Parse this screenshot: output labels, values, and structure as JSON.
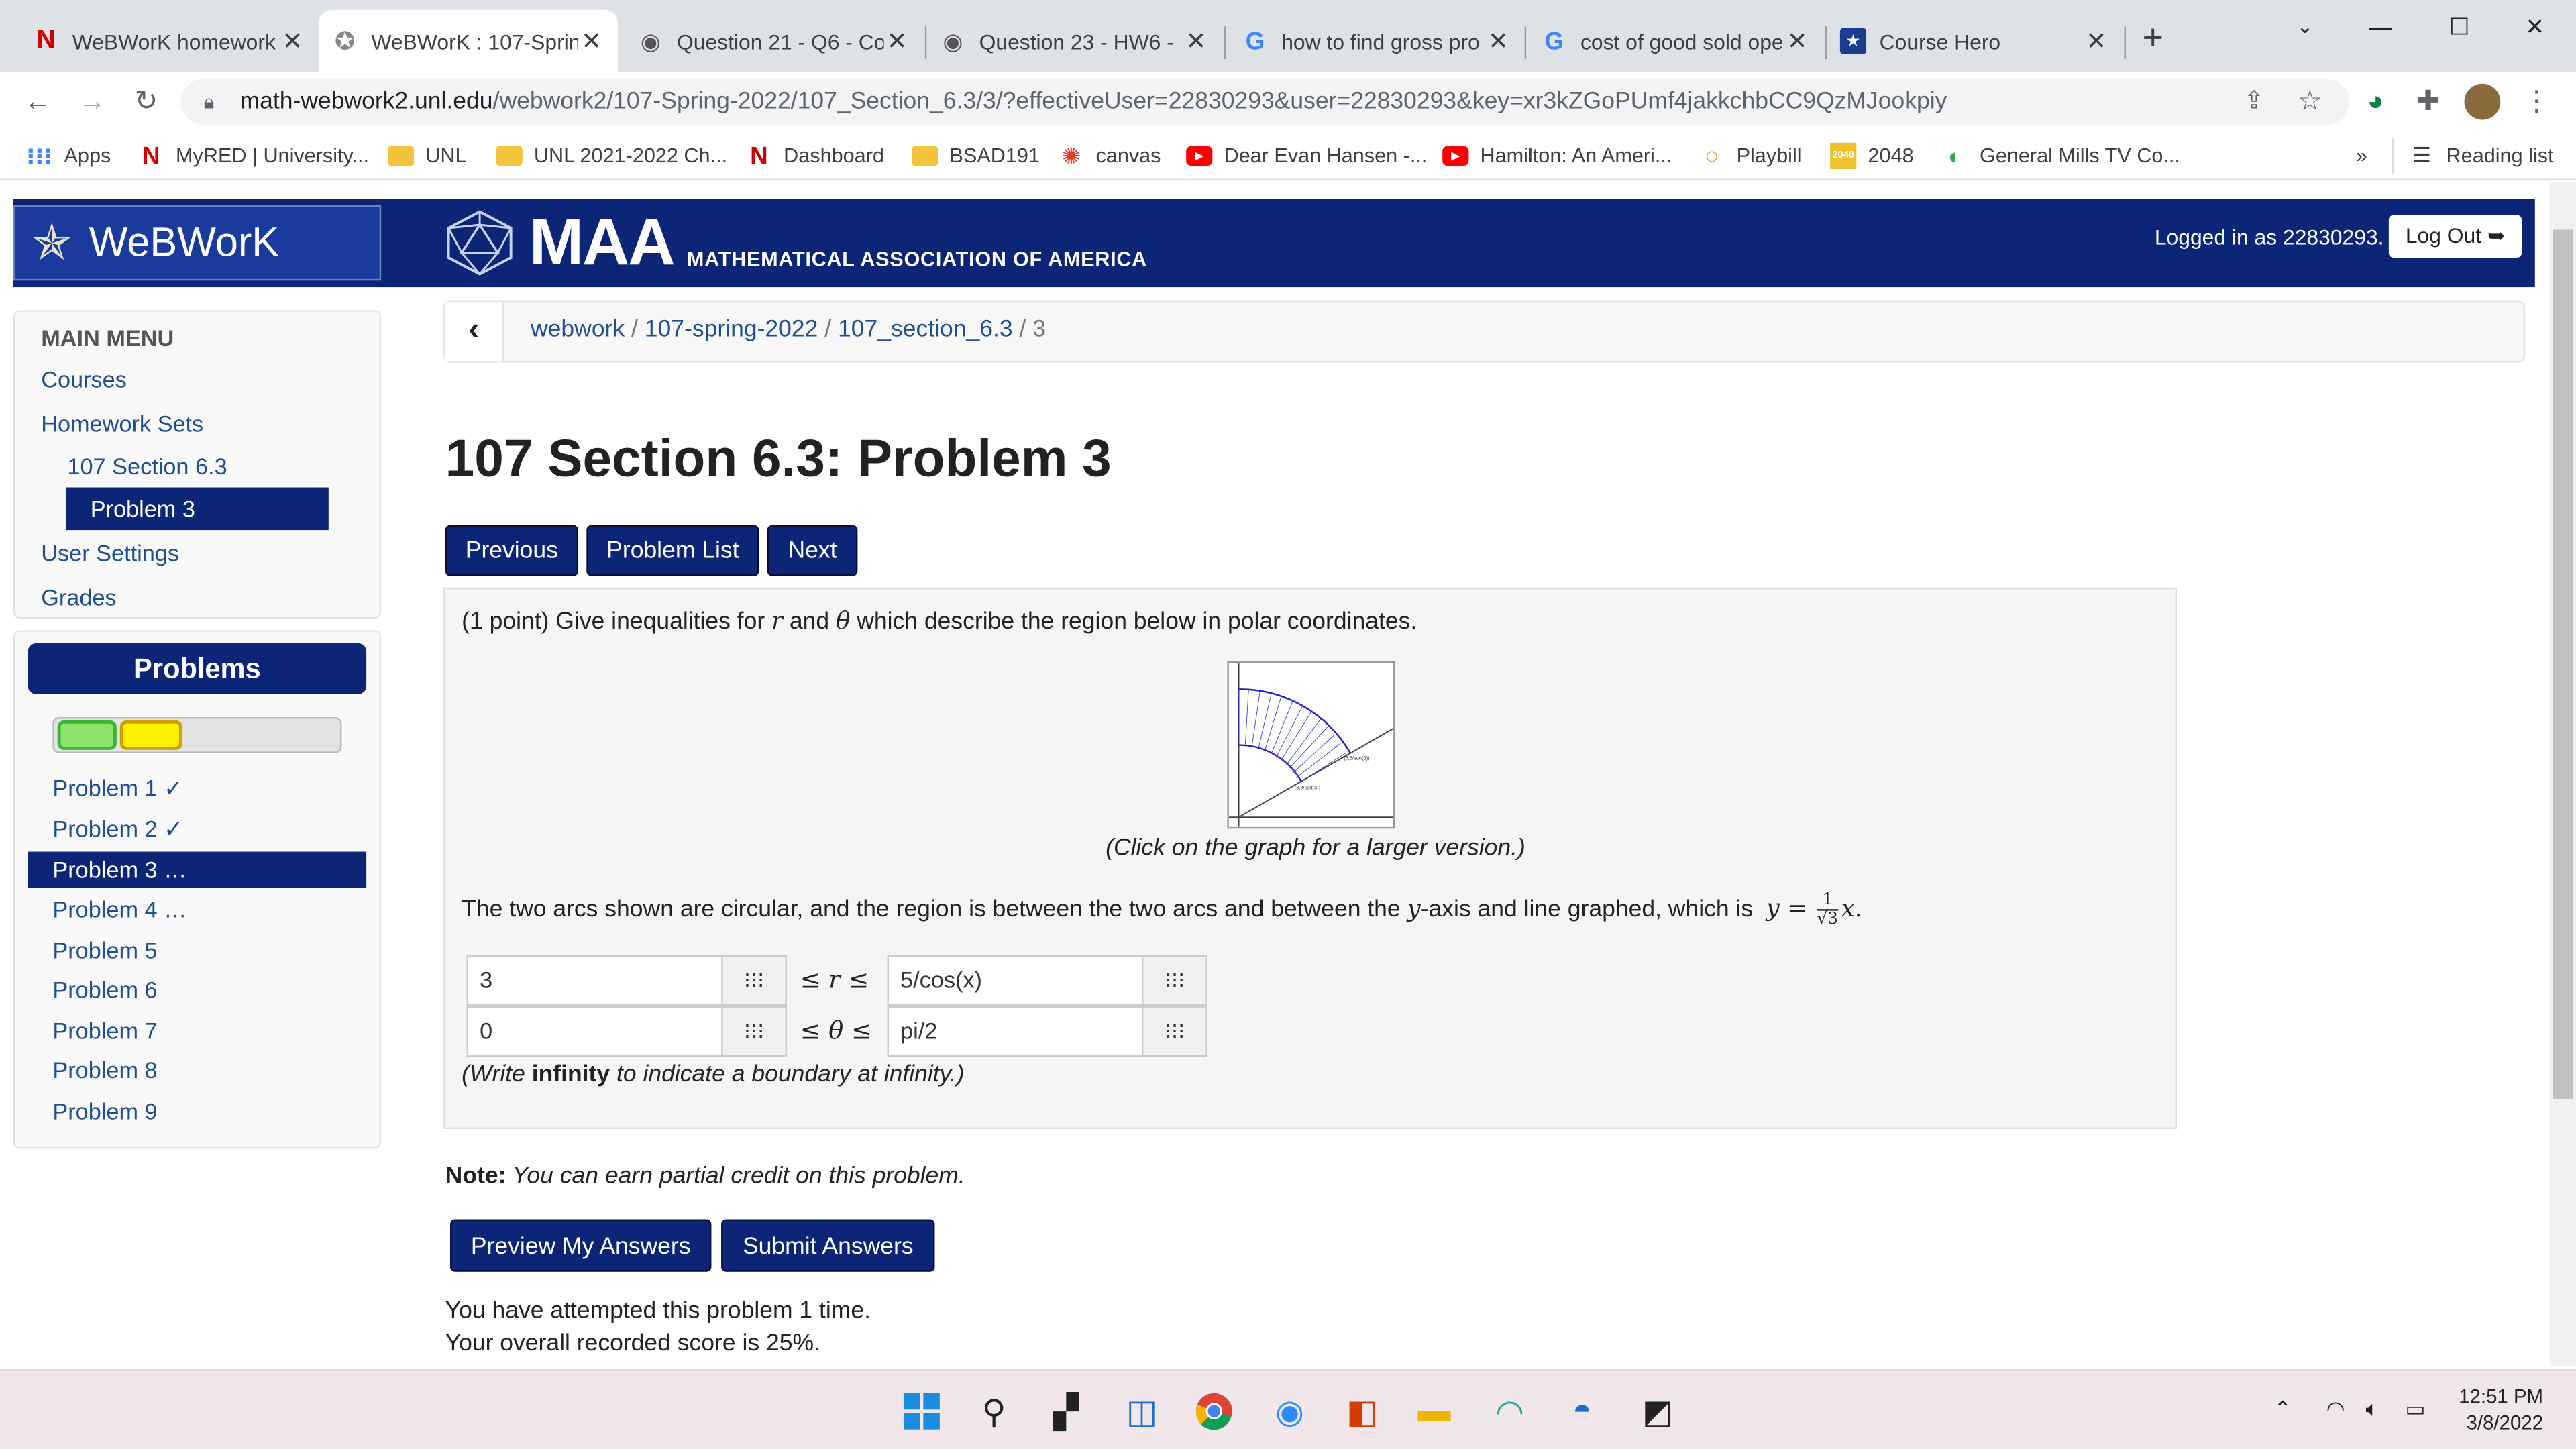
{
  "browser": {
    "tabs": [
      {
        "title": "WeBWorK homework",
        "favicon": "N",
        "active": false
      },
      {
        "title": "WeBWorK : 107-Spring",
        "favicon": "star",
        "active": true
      },
      {
        "title": "Question 21 - Q6 - Co",
        "favicon": "globe",
        "active": false
      },
      {
        "title": "Question 23 - HW6 -",
        "favicon": "globe",
        "active": false
      },
      {
        "title": "how to find gross pro",
        "favicon": "G",
        "active": false
      },
      {
        "title": "cost of good sold ope",
        "favicon": "G",
        "active": false
      },
      {
        "title": "Course Hero",
        "favicon": "ch",
        "active": false
      }
    ],
    "url_host": "math-webwork2.unl.edu",
    "url_path": "/webwork2/107-Spring-2022/107_Section_6.3/3/?effectiveUser=22830293&user=22830293&key=xr3kZGoPUmf4jakkchbCC9QzMJookpiy",
    "bookmarks": [
      "Apps",
      "MyRED | University...",
      "UNL",
      "UNL 2021-2022 Ch...",
      "Dashboard",
      "BSAD191",
      "canvas",
      "Dear Evan Hansen -...",
      "Hamilton: An Ameri...",
      "Playbill",
      "2048",
      "General Mills TV Co..."
    ],
    "bookmarks_more": "»",
    "reading_list": "Reading list"
  },
  "header": {
    "logo_text": "WeBWorK",
    "maa_big": "MAA",
    "maa_small": "MATHEMATICAL ASSOCIATION OF AMERICA",
    "logged_in": "Logged in as 22830293.",
    "logout": "Log Out"
  },
  "main_menu": {
    "heading": "MAIN MENU",
    "courses": "Courses",
    "homework_sets": "Homework Sets",
    "section": "107 Section 6.3",
    "problem": "Problem 3",
    "user_settings": "User Settings",
    "grades": "Grades"
  },
  "problems_panel": {
    "heading": "Problems",
    "progress_correct_fraction": 0.25,
    "progress_partial_fraction": 0.25,
    "items": [
      "Problem 1 ✓",
      "Problem 2 ✓",
      "Problem 3 …",
      "Problem 4 …",
      "Problem 5",
      "Problem 6",
      "Problem 7",
      "Problem 8",
      "Problem 9"
    ]
  },
  "breadcrumb": {
    "c1": "webwork",
    "c2": "107-spring-2022",
    "c3": "107_section_6.3",
    "c4": "3",
    "sep": "/"
  },
  "title": "107 Section 6.3: Problem 3",
  "nav": {
    "previous": "Previous",
    "list": "Problem List",
    "next": "Next"
  },
  "problem": {
    "intro_a": "(1 point) Give inequalities for ",
    "var_r": "r",
    "intro_b": " and ",
    "var_theta": "θ",
    "intro_c": " which describe the region below in polar coordinates.",
    "graph_caption": "(Click on the graph for a larger version.)",
    "graph_label_1": "(5,5/sqrt(3))",
    "graph_label_2": "(3,3/sqrt(3))",
    "desc_a": "The two arcs shown are circular, and the region is between the two arcs and between the ",
    "desc_var_y": "y",
    "desc_b": "-axis and line graphed, which is ",
    "desc_eq": "y =",
    "frac_num": "1",
    "frac_den": "√3",
    "desc_x": "x.",
    "r_lower": "3",
    "r_upper": "5/cos(x)",
    "theta_lower": "0",
    "theta_upper": "pi/2",
    "leq_r": "≤ r ≤",
    "leq_theta": "≤ θ ≤",
    "infinity_a": "(Write ",
    "infinity_b": "infinity",
    "infinity_c": " to indicate a boundary at infinity.)"
  },
  "note": {
    "label": "Note:",
    "text": " You can earn partial credit on this problem."
  },
  "submit": {
    "preview": "Preview My Answers",
    "submit": "Submit Answers"
  },
  "attempts": {
    "line1": "You have attempted this problem 1 time.",
    "line2": "Your overall recorded score is 25%."
  },
  "taskbar": {
    "time": "12:51 PM",
    "date": "3/8/2022"
  }
}
